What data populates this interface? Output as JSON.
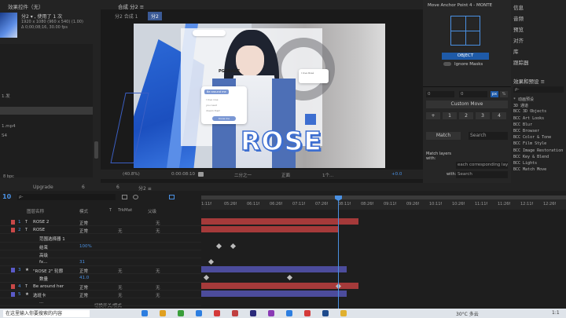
{
  "project": {
    "tab": "效果控件（无）",
    "name": "分2 ▾ , 使用了 1 次",
    "dims": "1920 x 1080 (960 x 540) (1.00)",
    "duration": "Δ 0;00;08;16, 30.00 fps",
    "items": [
      "1.发",
      "1.mp4",
      "S4"
    ],
    "bpc": "8 bpc"
  },
  "comp": {
    "tab": "合成 分2 ≡",
    "breadcrumb_1": "分2 合成 1",
    "breadcrumb_2": "分2",
    "zoom": "(40.8%)",
    "timecode": "0:00:08:10",
    "resolution": "二分之一",
    "view": "正面",
    "views": "1个...",
    "exposure": "+0.0"
  },
  "artwork": {
    "big_title": "ROSE",
    "label": "PGGRADE",
    "card_1_title": "Be around me",
    "card_1_rows": [
      "I love rose",
      "you need",
      "dream them"
    ],
    "card_1_button": "Know me",
    "card_2_title": "I love Rosé"
  },
  "anchor_panel": {
    "title": "Move Anchor Point 4 - MONTE",
    "object_button": "OBJECT",
    "ignore_masks": "Ignore Masks",
    "field_a": "0",
    "field_b": "0",
    "unit_px": "px",
    "unit_pct": "%",
    "custom_move": "Custom Move",
    "nums": [
      "+",
      "1",
      "2",
      "3",
      "4",
      "+",
      "1",
      "2",
      "3",
      "4"
    ],
    "match_label": "Match",
    "search_placeholder": "Search",
    "match_layers": "Match layers with:",
    "each_corr": "each corresponding lay",
    "with_label": "with:",
    "search_2": "Search",
    "bottom_nums": [
      "+",
      "1",
      "2",
      "3",
      "4"
    ]
  },
  "right_panel": {
    "items": [
      "信息",
      "音频",
      "预览",
      "对齐",
      "库",
      "跟踪器"
    ],
    "effects_title": "效果和预设 ≡",
    "search": "ρ-",
    "effects": [
      "* 动画预设",
      "3D 通道",
      "BCC 3D Objects",
      "BCC Art Looks",
      "BCC Blur",
      "BCC Browser",
      "BCC Color & Tone",
      "BCC Film Style",
      "BCC Image Restoration",
      "BCC Key & Blend",
      "BCC Lights",
      "BCC Match Move"
    ]
  },
  "timeline": {
    "tabs": [
      "Upgrade",
      "6",
      "6",
      "分2 ≡"
    ],
    "current_time": "10",
    "search": "ρ-",
    "col_name": "图层名称",
    "col_mode": "模式",
    "col_t": "T",
    "col_trkmat": "TrkMat",
    "col_parent": "父级",
    "ruler": [
      "1:11f",
      "05:26f",
      "06:11f",
      "06:26f",
      "07:11f",
      "07:26f",
      "08:11f",
      "08:26f",
      "09:11f",
      "09:26f",
      "10:11f",
      "10:26f",
      "11:11f",
      "11:26f",
      "12:11f",
      "12:26f"
    ],
    "layers": [
      {
        "num": "1",
        "name": "ROSE 2",
        "mode": "正常",
        "trk": "",
        "parent": "无",
        "color": "#c84848",
        "type": "T"
      },
      {
        "num": "2",
        "name": "ROSE",
        "mode": "正常",
        "trk": "无",
        "parent": "无",
        "color": "#c84848",
        "type": "T"
      },
      {
        "num": "",
        "name": "范围选择器 1",
        "mode": "",
        "trk": "",
        "parent": "",
        "color": "",
        "type": ""
      },
      {
        "num": "",
        "name": "结束",
        "mode": "100%",
        "trk": "",
        "parent": "",
        "color": "",
        "type": ""
      },
      {
        "num": "",
        "name": "高级",
        "mode": "",
        "trk": "",
        "parent": "",
        "color": "",
        "type": ""
      },
      {
        "num": "",
        "name": "fx...",
        "mode": "31",
        "trk": "",
        "parent": "",
        "color": "",
        "type": ""
      },
      {
        "num": "3",
        "name": "\"ROSE 2\" 轮廓",
        "mode": "正常",
        "trk": "无",
        "parent": "无",
        "color": "#5a5ac8",
        "type": "★"
      },
      {
        "num": "",
        "name": "数量",
        "mode": "41.0",
        "trk": "",
        "parent": "",
        "color": "",
        "type": ""
      },
      {
        "num": "4",
        "name": "Be around her",
        "mode": "正常",
        "trk": "无",
        "parent": "无",
        "color": "#c84848",
        "type": "T"
      },
      {
        "num": "5",
        "name": "选班卡",
        "mode": "正常",
        "trk": "无",
        "parent": "无",
        "color": "#5a5ac8",
        "type": "★"
      },
      {
        "num": "",
        "name": "...",
        "mode": "",
        "trk": "",
        "parent": "",
        "color": "",
        "type": ""
      }
    ],
    "footer": "切换开关/模式"
  },
  "taskbar": {
    "search": "在这里输入你要搜索的内容",
    "weather": "30°C 多云",
    "time": "1:1"
  }
}
